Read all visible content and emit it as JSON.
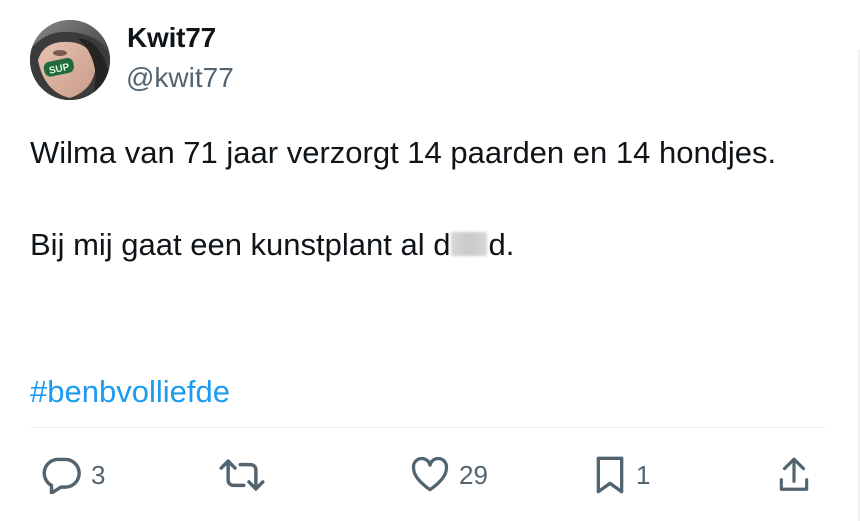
{
  "author": {
    "display_name": "Kwit77",
    "handle": "@kwit77",
    "avatar_sticker_text": "SUP"
  },
  "tweet": {
    "line1": "Wilma van 71 jaar verzorgt 14 paarden en 14 hondjes.",
    "line2_before": "Bij mij gaat een kunstplant al d",
    "line2_after": "d.",
    "hashtag": "#benbvolliefde"
  },
  "actions": {
    "replies": "3",
    "retweets": "",
    "likes": "29",
    "bookmarks": "1"
  },
  "colors": {
    "link": "#1d9bf0",
    "muted": "#536471",
    "text": "#0f1419",
    "divider": "#eff3f4"
  },
  "icons": [
    "reply-icon",
    "retweet-icon",
    "like-icon",
    "bookmark-icon",
    "share-icon"
  ]
}
